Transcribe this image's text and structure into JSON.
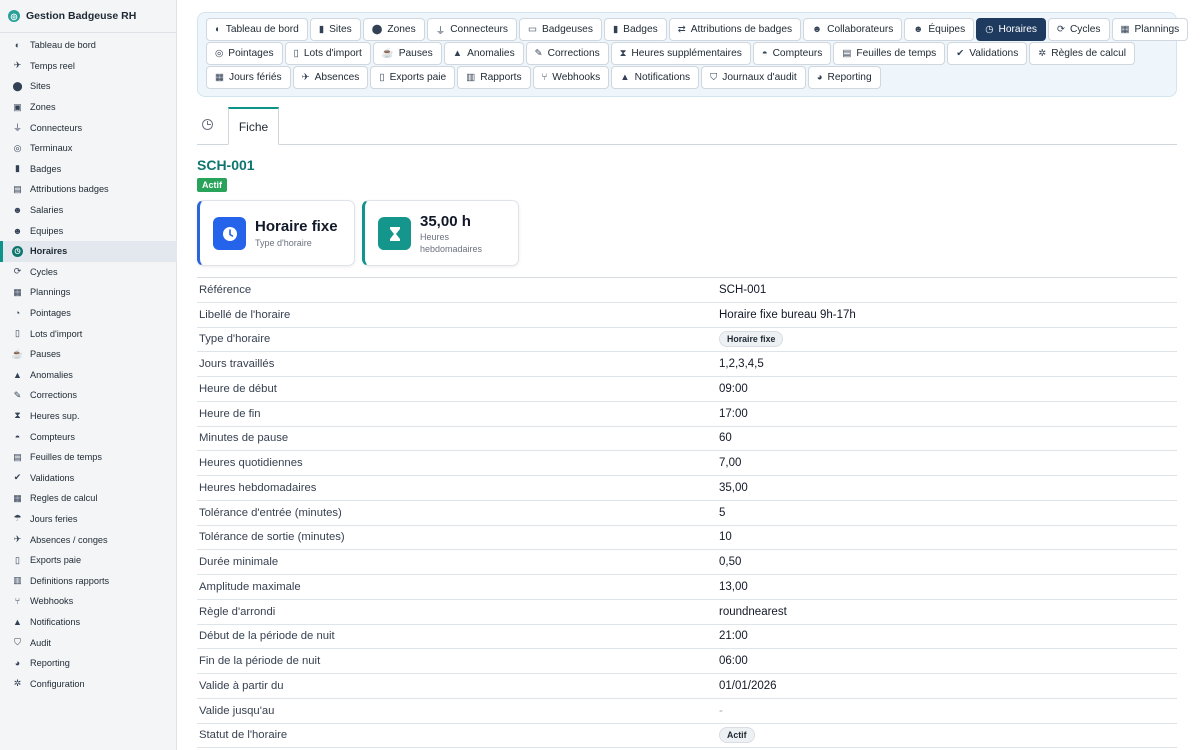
{
  "app": {
    "title": "Gestion Badgeuse RH"
  },
  "sidebar": {
    "items": [
      {
        "label": "Tableau de bord",
        "icon": "gauge-icon",
        "glyph": "◐"
      },
      {
        "label": "Temps reel",
        "icon": "satellite-icon",
        "glyph": "✈"
      },
      {
        "label": "Sites",
        "icon": "map-pin-icon",
        "glyph": "⬤"
      },
      {
        "label": "Zones",
        "icon": "zone-icon",
        "glyph": "▣"
      },
      {
        "label": "Connecteurs",
        "icon": "plug-icon",
        "glyph": "⏚"
      },
      {
        "label": "Terminaux",
        "icon": "fingerprint-icon",
        "glyph": "◎"
      },
      {
        "label": "Badges",
        "icon": "badge-icon",
        "glyph": "▮"
      },
      {
        "label": "Attributions badges",
        "icon": "id-card-icon",
        "glyph": "▤"
      },
      {
        "label": "Salaries",
        "icon": "users-icon",
        "glyph": "☻"
      },
      {
        "label": "Equipes",
        "icon": "team-icon",
        "glyph": "☻"
      },
      {
        "label": "Horaires",
        "icon": "clock-icon",
        "glyph": "◷"
      },
      {
        "label": "Cycles",
        "icon": "sync-icon",
        "glyph": "⟳"
      },
      {
        "label": "Plannings",
        "icon": "calendar-icon",
        "glyph": "▦"
      },
      {
        "label": "Pointages",
        "icon": "stopwatch-icon",
        "glyph": "◔"
      },
      {
        "label": "Lots d'import",
        "icon": "file-import-icon",
        "glyph": "▯"
      },
      {
        "label": "Pauses",
        "icon": "coffee-icon",
        "glyph": "☕"
      },
      {
        "label": "Anomalies",
        "icon": "warning-icon",
        "glyph": "▲"
      },
      {
        "label": "Corrections",
        "icon": "edit-icon",
        "glyph": "✎"
      },
      {
        "label": "Heures sup.",
        "icon": "hourglass-icon",
        "glyph": "⧗"
      },
      {
        "label": "Compteurs",
        "icon": "gauge-icon",
        "glyph": "◓"
      },
      {
        "label": "Feuilles de temps",
        "icon": "timesheet-icon",
        "glyph": "▤"
      },
      {
        "label": "Validations",
        "icon": "check-double-icon",
        "glyph": "✔"
      },
      {
        "label": "Regles de calcul",
        "icon": "calculator-icon",
        "glyph": "▦"
      },
      {
        "label": "Jours feries",
        "icon": "umbrella-beach-icon",
        "glyph": "☂"
      },
      {
        "label": "Absences / conges",
        "icon": "plane-icon",
        "glyph": "✈"
      },
      {
        "label": "Exports paie",
        "icon": "file-export-icon",
        "glyph": "▯"
      },
      {
        "label": "Definitions rapports",
        "icon": "chart-icon",
        "glyph": "▥"
      },
      {
        "label": "Webhooks",
        "icon": "code-branch-icon",
        "glyph": "⑂"
      },
      {
        "label": "Notifications",
        "icon": "bell-icon",
        "glyph": "▲"
      },
      {
        "label": "Audit",
        "icon": "shield-icon",
        "glyph": "⛉"
      },
      {
        "label": "Reporting",
        "icon": "pie-chart-icon",
        "glyph": "◕"
      },
      {
        "label": "Configuration",
        "icon": "gear-icon",
        "glyph": "✲"
      }
    ],
    "active_index": 10
  },
  "modules": {
    "rows": [
      [
        {
          "label": "Tableau de bord",
          "icon": "gauge-icon",
          "glyph": "◐"
        },
        {
          "label": "Sites",
          "icon": "building-icon",
          "glyph": "▮"
        },
        {
          "label": "Zones",
          "icon": "map-pin-icon",
          "glyph": "⬤"
        },
        {
          "label": "Connecteurs",
          "icon": "plug-icon",
          "glyph": "⏚"
        },
        {
          "label": "Badgeuses",
          "icon": "tablet-icon",
          "glyph": "▭"
        },
        {
          "label": "Badges",
          "icon": "badge-icon",
          "glyph": "▮"
        },
        {
          "label": "Attributions de badges",
          "icon": "exchange-icon",
          "glyph": "⇄"
        },
        {
          "label": "Collaborateurs",
          "icon": "user-icon",
          "glyph": "☻"
        },
        {
          "label": "Équipes",
          "icon": "users-icon",
          "glyph": "☻"
        },
        {
          "label": "Horaires",
          "icon": "clock-icon",
          "glyph": "◷"
        },
        {
          "label": "Cycles",
          "icon": "sync-icon",
          "glyph": "⟳"
        },
        {
          "label": "Plannings",
          "icon": "calendar-icon",
          "glyph": "▦"
        }
      ],
      [
        {
          "label": "Pointages",
          "icon": "fingerprint-icon",
          "glyph": "◎"
        },
        {
          "label": "Lots d'import",
          "icon": "file-import-icon",
          "glyph": "▯"
        },
        {
          "label": "Pauses",
          "icon": "coffee-icon",
          "glyph": "☕"
        },
        {
          "label": "Anomalies",
          "icon": "warning-icon",
          "glyph": "▲"
        },
        {
          "label": "Corrections",
          "icon": "edit-icon",
          "glyph": "✎"
        },
        {
          "label": "Heures supplémentaires",
          "icon": "hourglass-icon",
          "glyph": "⧗"
        },
        {
          "label": "Compteurs",
          "icon": "gauge-icon",
          "glyph": "◓"
        },
        {
          "label": "Feuilles de temps",
          "icon": "table-icon",
          "glyph": "▤"
        },
        {
          "label": "Validations",
          "icon": "check-double-icon",
          "glyph": "✔"
        },
        {
          "label": "Règles de calcul",
          "icon": "gears-icon",
          "glyph": "✲"
        }
      ],
      [
        {
          "label": "Jours fériés",
          "icon": "calendar-day-icon",
          "glyph": "▦"
        },
        {
          "label": "Absences",
          "icon": "plane-icon",
          "glyph": "✈"
        },
        {
          "label": "Exports paie",
          "icon": "file-export-icon",
          "glyph": "▯"
        },
        {
          "label": "Rapports",
          "icon": "chart-icon",
          "glyph": "▥"
        },
        {
          "label": "Webhooks",
          "icon": "sitemap-icon",
          "glyph": "⑂"
        },
        {
          "label": "Notifications",
          "icon": "bell-icon",
          "glyph": "▲"
        },
        {
          "label": "Journaux d'audit",
          "icon": "shield-icon",
          "glyph": "⛉"
        },
        {
          "label": "Reporting",
          "icon": "pie-chart-icon",
          "glyph": "◕"
        }
      ]
    ],
    "active_label": "Horaires"
  },
  "subtabs": {
    "fiche": "Fiche"
  },
  "record": {
    "title": "SCH-001",
    "status_badge": "Actif"
  },
  "cards": [
    {
      "value": "Horaire fixe",
      "label": "Type d'horaire",
      "icon": "clock-icon"
    },
    {
      "value": "35,00 h",
      "label": "Heures hebdomadaires",
      "icon": "hourglass-icon"
    }
  ],
  "details": [
    {
      "label": "Référence",
      "value": "SCH-001"
    },
    {
      "label": "Libellé de l'horaire",
      "value": "Horaire fixe bureau 9h-17h"
    },
    {
      "label": "Type d'horaire",
      "value": "Horaire fixe",
      "pill": true
    },
    {
      "label": "Jours travaillés",
      "value": "1,2,3,4,5"
    },
    {
      "label": "Heure de début",
      "value": "09:00"
    },
    {
      "label": "Heure de fin",
      "value": "17:00"
    },
    {
      "label": "Minutes de pause",
      "value": "60"
    },
    {
      "label": "Heures quotidiennes",
      "value": "7,00"
    },
    {
      "label": "Heures hebdomadaires",
      "value": "35,00"
    },
    {
      "label": "Tolérance d'entrée (minutes)",
      "value": "5"
    },
    {
      "label": "Tolérance de sortie (minutes)",
      "value": "10"
    },
    {
      "label": "Durée minimale",
      "value": "0,50"
    },
    {
      "label": "Amplitude maximale",
      "value": "13,00"
    },
    {
      "label": "Règle d'arrondi",
      "value": "roundnearest"
    },
    {
      "label": "Début de la période de nuit",
      "value": "21:00"
    },
    {
      "label": "Fin de la période de nuit",
      "value": "06:00"
    },
    {
      "label": "Valide à partir du",
      "value": "01/01/2026"
    },
    {
      "label": "Valide jusqu'au",
      "value": "-",
      "muted": true
    },
    {
      "label": "Statut de l'horaire",
      "value": "Actif",
      "pill": true
    }
  ]
}
